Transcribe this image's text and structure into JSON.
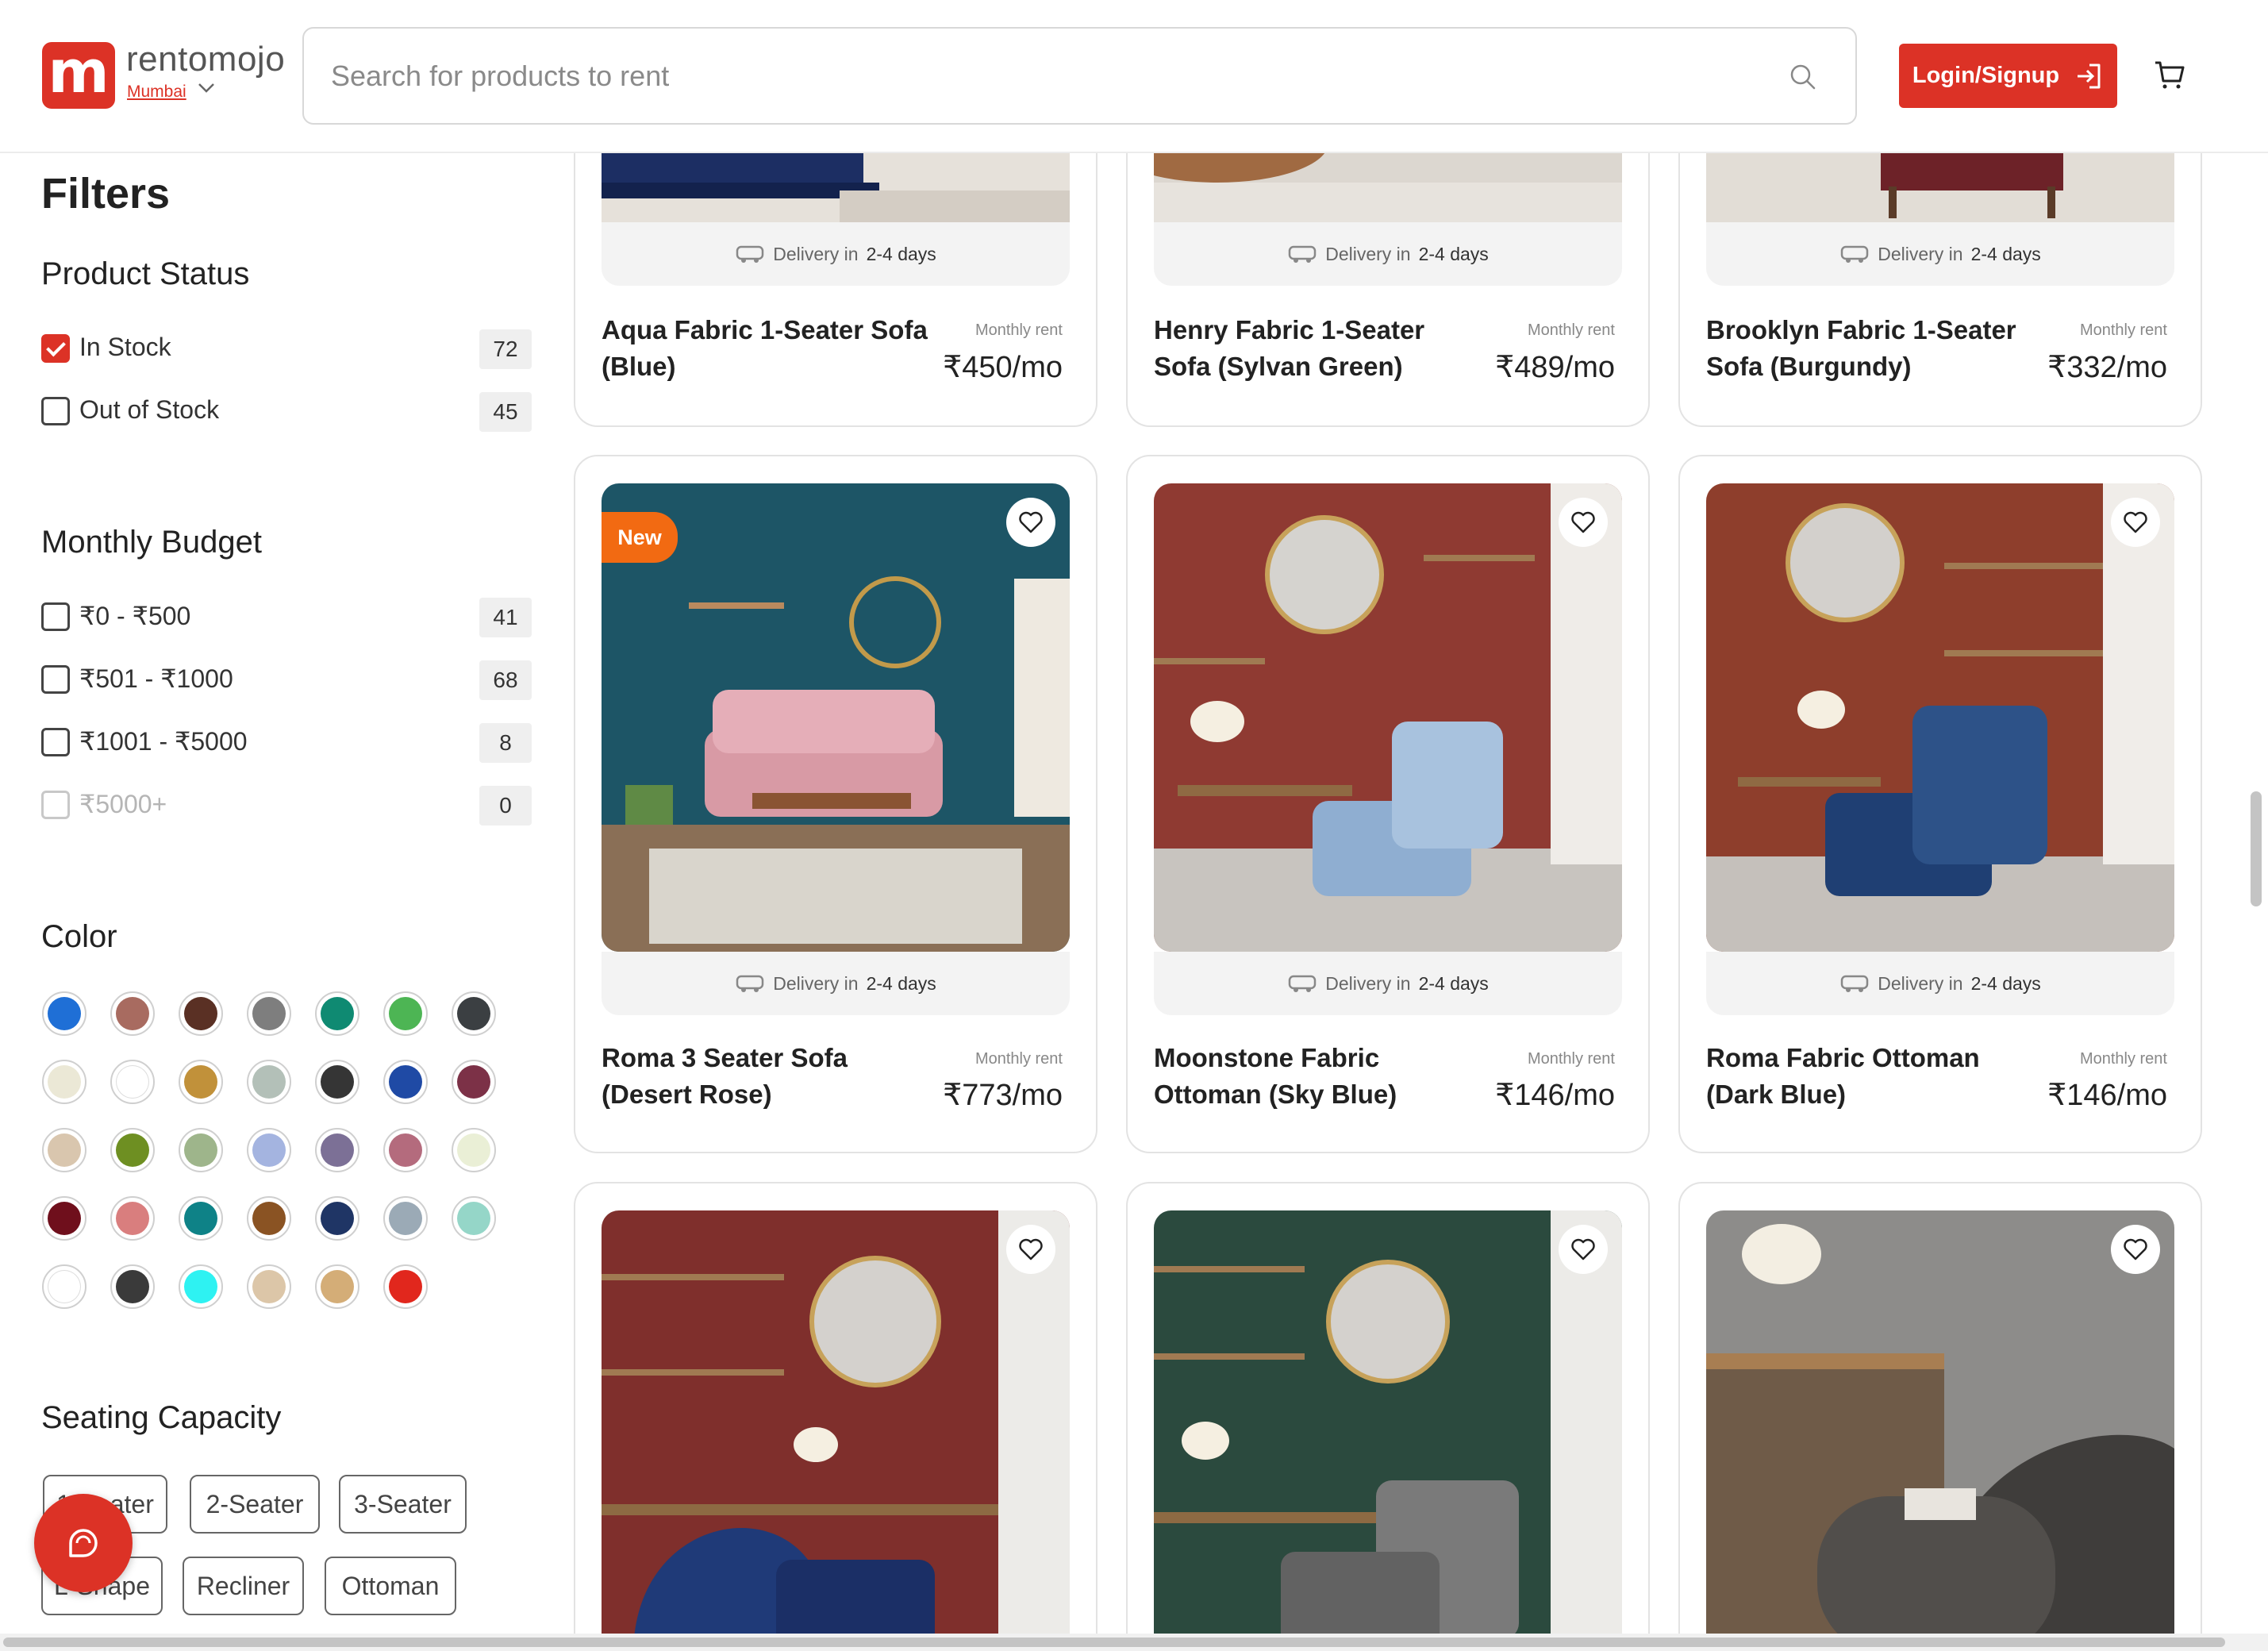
{
  "brand": {
    "logo_letter": "m",
    "name": "rentomojo",
    "city": "Mumbai",
    "brand_color": "#dc3226"
  },
  "search": {
    "placeholder": "Search for products to rent",
    "value": ""
  },
  "header": {
    "login_label": "Login/Signup"
  },
  "filters": {
    "title": "Filters",
    "product_status": {
      "title": "Product Status",
      "options": [
        {
          "label": "In Stock",
          "count": "72",
          "checked": true
        },
        {
          "label": "Out of Stock",
          "count": "45",
          "checked": false
        }
      ]
    },
    "monthly_budget": {
      "title": "Monthly Budget",
      "options": [
        {
          "label": "₹0 - ₹500",
          "count": "41"
        },
        {
          "label": "₹501 - ₹1000",
          "count": "68"
        },
        {
          "label": "₹1001 - ₹5000",
          "count": "8"
        },
        {
          "label": "₹5000+",
          "count": "0",
          "disabled": true
        }
      ]
    },
    "color": {
      "title": "Color",
      "swatches": [
        "#1f6fd6",
        "#a86b60",
        "#5a3024",
        "#7e7e7e",
        "#0f8a72",
        "#4db554",
        "#3b3f42",
        "#ebe8d6",
        "#ffffff",
        "#c1913a",
        "#b3c0b8",
        "#353535",
        "#1f4aa5",
        "#7c3147",
        "#d9c6ae",
        "#6e8f22",
        "#9eb58b",
        "#a4b4e0",
        "#7c7096",
        "#b46b7d",
        "#eaefd6",
        "#6f0f1c",
        "#d97e7e",
        "#0e8287",
        "#8a5323",
        "#1f3565",
        "#9baab6",
        "#95d6c8",
        "#ffffff",
        "#3a3a3a",
        "#2ef2f2",
        "#dcc6a8",
        "#d4ad77",
        "#e1271d"
      ]
    },
    "seating_capacity": {
      "title": "Seating Capacity",
      "chips": [
        "1-Seater",
        "2-Seater",
        "3-Seater",
        "L-Shape",
        "Recliner",
        "Ottoman"
      ]
    }
  },
  "products": [
    {
      "name": "Aqua Fabric 1-Seater Sofa (Blue)",
      "rent_label": "Monthly rent",
      "price": "₹450/mo",
      "delivery_prefix": "Delivery in",
      "delivery_days": "2-4 days"
    },
    {
      "name": "Henry Fabric 1-Seater Sofa (Sylvan Green)",
      "rent_label": "Monthly rent",
      "price": "₹489/mo",
      "delivery_prefix": "Delivery in",
      "delivery_days": "2-4 days"
    },
    {
      "name": "Brooklyn Fabric 1-Seater Sofa (Burgundy)",
      "rent_label": "Monthly rent",
      "price": "₹332/mo",
      "delivery_prefix": "Delivery in",
      "delivery_days": "2-4 days"
    },
    {
      "name": "Roma 3 Seater Sofa (Desert Rose)",
      "rent_label": "Monthly rent",
      "price": "₹773/mo",
      "delivery_prefix": "Delivery in",
      "delivery_days": "2-4 days",
      "badge": "New"
    },
    {
      "name": "Moonstone Fabric Ottoman (Sky Blue)",
      "rent_label": "Monthly rent",
      "price": "₹146/mo",
      "delivery_prefix": "Delivery in",
      "delivery_days": "2-4 days"
    },
    {
      "name": "Roma Fabric Ottoman (Dark Blue)",
      "rent_label": "Monthly rent",
      "price": "₹146/mo",
      "delivery_prefix": "Delivery in",
      "delivery_days": "2-4 days"
    }
  ],
  "icons": {
    "search": "search-icon",
    "login": "login-icon",
    "cart": "cart-icon",
    "heart": "heart-icon",
    "truck": "truck-icon",
    "support": "support-chat-icon",
    "chevron": "chevron-down-icon"
  }
}
